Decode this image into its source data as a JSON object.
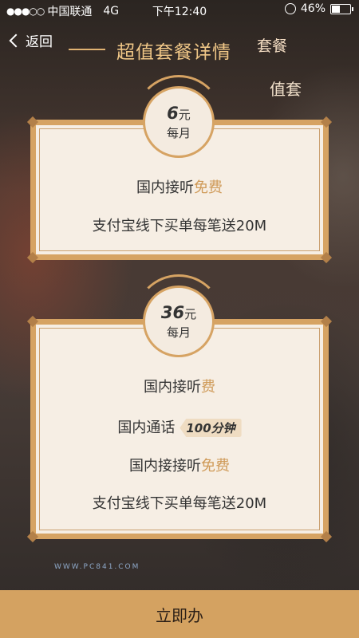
{
  "status_bar": {
    "carrier": "中国联通",
    "network": "4G",
    "time": "下午12:40",
    "battery": "46%"
  },
  "nav": {
    "back_label": "返回",
    "title": "超值套餐详情",
    "title_extra": "套餐"
  },
  "side_text": "值套",
  "package1": {
    "price": "6",
    "price_unit": "元",
    "period": "每月",
    "feature1_prefix": "国内接听",
    "feature1_highlight": "免费",
    "feature2": "支付宝线下买单每笔送20M"
  },
  "package2": {
    "price": "36",
    "price_unit": "元",
    "period": "每月",
    "feature1_prefix": "国内接听",
    "feature1_highlight": "费",
    "call_label": "国内通话",
    "call_minutes": "100分钟",
    "feature3_prefix": "国内接接听",
    "feature3_highlight": "免费",
    "feature4": "支付宝线下买单每笔送20M"
  },
  "watermark": "WWW.PC841.COM",
  "cta_label": "立即办"
}
